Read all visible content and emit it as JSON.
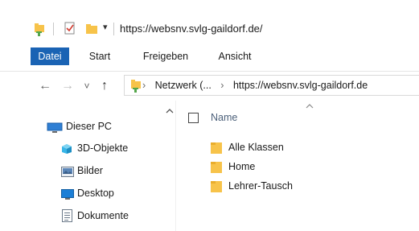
{
  "window": {
    "title": "https://websnv.svlg-gaildorf.de/"
  },
  "quick_access": {
    "dropdown_glyph": "▾"
  },
  "ribbon": {
    "tabs": [
      {
        "label": "Datei",
        "active": true
      },
      {
        "label": "Start",
        "active": false
      },
      {
        "label": "Freigeben",
        "active": false
      },
      {
        "label": "Ansicht",
        "active": false
      }
    ]
  },
  "navigation": {
    "back_glyph": "←",
    "forward_glyph": "→",
    "recent_glyph": "˅",
    "up_glyph": "↑"
  },
  "address_bar": {
    "breadcrumbs": [
      "Netzwerk (...",
      "https://websnv.svlg-gaildorf.de"
    ],
    "separator": "›"
  },
  "nav_pane": {
    "items": [
      {
        "label": "Dieser PC",
        "icon": "computer-icon"
      },
      {
        "label": "3D-Objekte",
        "icon": "3d-objects-icon"
      },
      {
        "label": "Bilder",
        "icon": "pictures-icon"
      },
      {
        "label": "Desktop",
        "icon": "desktop-icon"
      },
      {
        "label": "Dokumente",
        "icon": "documents-icon"
      }
    ]
  },
  "file_list": {
    "column_name": "Name",
    "items": [
      {
        "name": "Alle Klassen",
        "icon": "folder-icon"
      },
      {
        "name": "Home",
        "icon": "folder-icon"
      },
      {
        "name": "Lehrer-Tausch",
        "icon": "folder-icon"
      }
    ]
  },
  "colors": {
    "accent": "#1a63b4",
    "folder": "#f7c34a",
    "column_header": "#4c607a"
  }
}
